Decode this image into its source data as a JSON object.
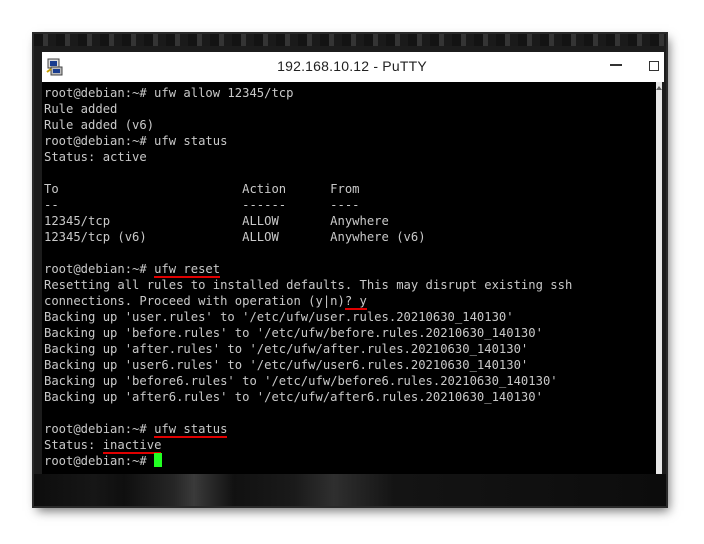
{
  "window": {
    "title": "192.168.10.12 - PuTTY",
    "icon": "putty-icon"
  },
  "terminal": {
    "lines": [
      "root@debian:~# ufw allow 12345/tcp",
      "Rule added",
      "Rule added (v6)",
      "root@debian:~# ufw status",
      "Status: active",
      "",
      "To                         Action      From",
      "--                         ------      ----",
      "12345/tcp                  ALLOW       Anywhere",
      "12345/tcp (v6)             ALLOW       Anywhere (v6)",
      "",
      "root@debian:~# ufw reset",
      "Resetting all rules to installed defaults. This may disrupt existing ssh",
      "connections. Proceed with operation (y|n)? y",
      "Backing up 'user.rules' to '/etc/ufw/user.rules.20210630_140130'",
      "Backing up 'before.rules' to '/etc/ufw/before.rules.20210630_140130'",
      "Backing up 'after.rules' to '/etc/ufw/after.rules.20210630_140130'",
      "Backing up 'user6.rules' to '/etc/ufw/user6.rules.20210630_140130'",
      "Backing up 'before6.rules' to '/etc/ufw/before6.rules.20210630_140130'",
      "Backing up 'after6.rules' to '/etc/ufw/after6.rules.20210630_140130'",
      "",
      "root@debian:~# ufw status",
      "Status: inactive",
      "root@debian:~# "
    ],
    "prompt": "root@debian:~# ",
    "highlights": {
      "reset_command": "ufw reset",
      "confirm_answer": "? y",
      "status_command": "ufw status",
      "inactive_status": "inactive"
    }
  },
  "colors": {
    "terminal_bg": "#000000",
    "terminal_text": "#c9c9c9",
    "cursor": "#22ff22",
    "annotation_underline": "#e00000"
  }
}
